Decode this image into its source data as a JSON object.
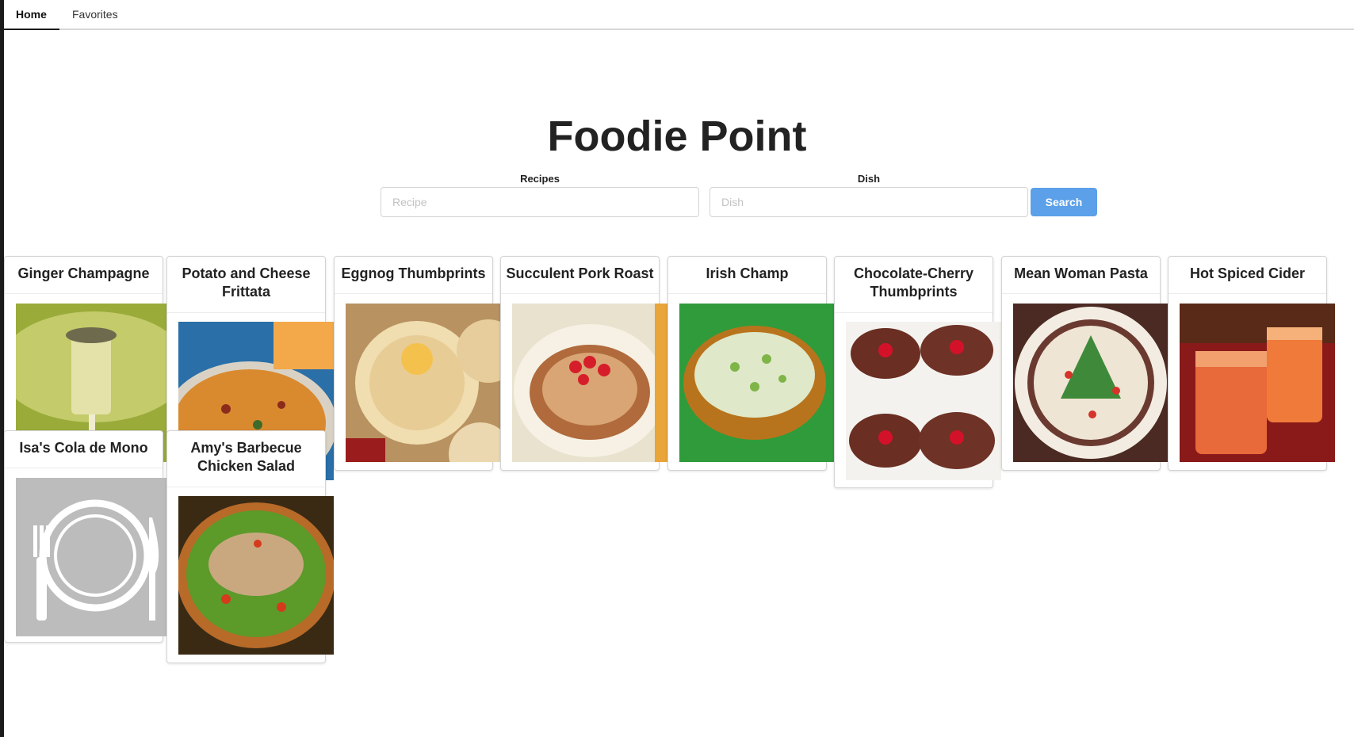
{
  "menu": {
    "items": [
      {
        "label": "Home",
        "active": true
      },
      {
        "label": "Favorites",
        "active": false
      }
    ]
  },
  "title": "Foodie Point",
  "search": {
    "recipes_label": "Recipes",
    "recipe_placeholder": "Recipe",
    "recipe_value": "",
    "dish_label": "Dish",
    "dish_placeholder": "Dish",
    "dish_value": "",
    "button_label": "Search",
    "button_color": "#5ba0e8"
  },
  "recipes": [
    {
      "name": "Ginger Champagne",
      "image": "champagne-glass"
    },
    {
      "name": "Potato and Cheese Frittata",
      "image": "frittata"
    },
    {
      "name": "Eggnog Thumbprints",
      "image": "cookies"
    },
    {
      "name": "Succulent Pork Roast",
      "image": "pork-roast"
    },
    {
      "name": "Irish Champ",
      "image": "mashed-potatoes-bowl"
    },
    {
      "name": "Chocolate-Cherry Thumbprints",
      "image": "chocolate-cookies"
    },
    {
      "name": "Mean Woman Pasta",
      "image": "pasta-plate"
    },
    {
      "name": "Hot Spiced Cider",
      "image": "cider-glasses"
    },
    {
      "name": "Isa's Cola de Mono",
      "image": "plate-placeholder"
    },
    {
      "name": "Amy's Barbecue Chicken Salad",
      "image": "chicken-salad"
    }
  ]
}
